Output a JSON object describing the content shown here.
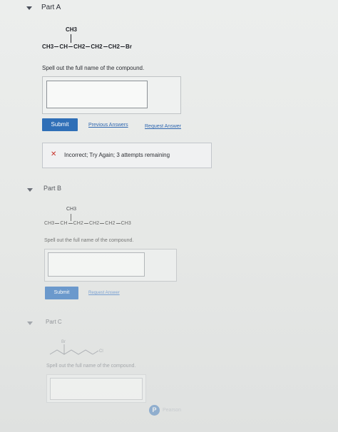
{
  "colors": {
    "accent": "#2f6fb7",
    "error": "#c8322a",
    "background": "#e9ebe8"
  },
  "part_a": {
    "title": "Part A",
    "branch": "CH3",
    "formula_parts": [
      "CH3",
      "CH",
      "CH2",
      "CH2",
      "CH2",
      "Br"
    ],
    "prompt": "Spell out the full name of the compound.",
    "answer_value": "",
    "submit_label": "Submit",
    "previous_answers_label": "Previous Answers",
    "request_answer_label": "Request Answer",
    "feedback": "Incorrect; Try Again; 3 attempts remaining",
    "feedback_icon": "x-icon"
  },
  "part_b": {
    "title": "Part B",
    "branch": "CH3",
    "formula_parts": [
      "CH3",
      "CH",
      "CH2",
      "CH2",
      "CH2",
      "CH3"
    ],
    "prompt": "Spell out the full name of the compound.",
    "answer_value": "",
    "submit_label": "Submit",
    "request_answer_label": "Request Answer"
  },
  "part_c": {
    "title": "Part C",
    "structure_labels": [
      "Br",
      "Cl"
    ],
    "prompt": "Spell out the full name of the compound.",
    "answer_value": "",
    "footer_logo": "P",
    "footer_text": "Pearson"
  }
}
